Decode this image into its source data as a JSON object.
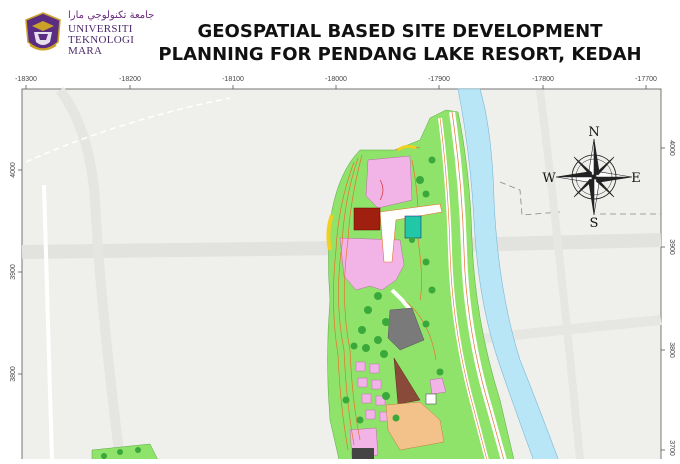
{
  "header": {
    "university_script": "جامعة تكنولوجي مارا",
    "university_lines": [
      "UNIVERSITI",
      "TEKNOLOGI",
      "MARA"
    ],
    "title_line1": "GEOSPATIAL BASED SITE DEVELOPMENT",
    "title_line2": "PLANNING FOR PENDANG LAKE RESORT, KEDAH"
  },
  "map": {
    "x_ticks": [
      "-18300",
      "-18200",
      "-18100",
      "-18000",
      "-17900",
      "-17800",
      "-17700"
    ],
    "y_ticks_left": [
      "4000",
      "3900",
      "3800"
    ],
    "y_ticks_right": [
      "4000",
      "3900",
      "3800",
      "3700"
    ],
    "compass": {
      "n": "N",
      "s": "S",
      "e": "E",
      "w": "W"
    },
    "colors": {
      "land": "#efefec",
      "road": "#e3e3e0",
      "grass": "#8fe36a",
      "water": "#b8e6f7",
      "pink": "#f2b4e6",
      "orange_lines": "#e8732a",
      "red_lines": "#d02020",
      "tan": "#f2c28a",
      "dark_grey": "#7a7a7a",
      "brown": "#8a4a3a",
      "dark_red": "#a02010",
      "teal": "#20c8a8",
      "tree": "#3aa83a"
    }
  }
}
